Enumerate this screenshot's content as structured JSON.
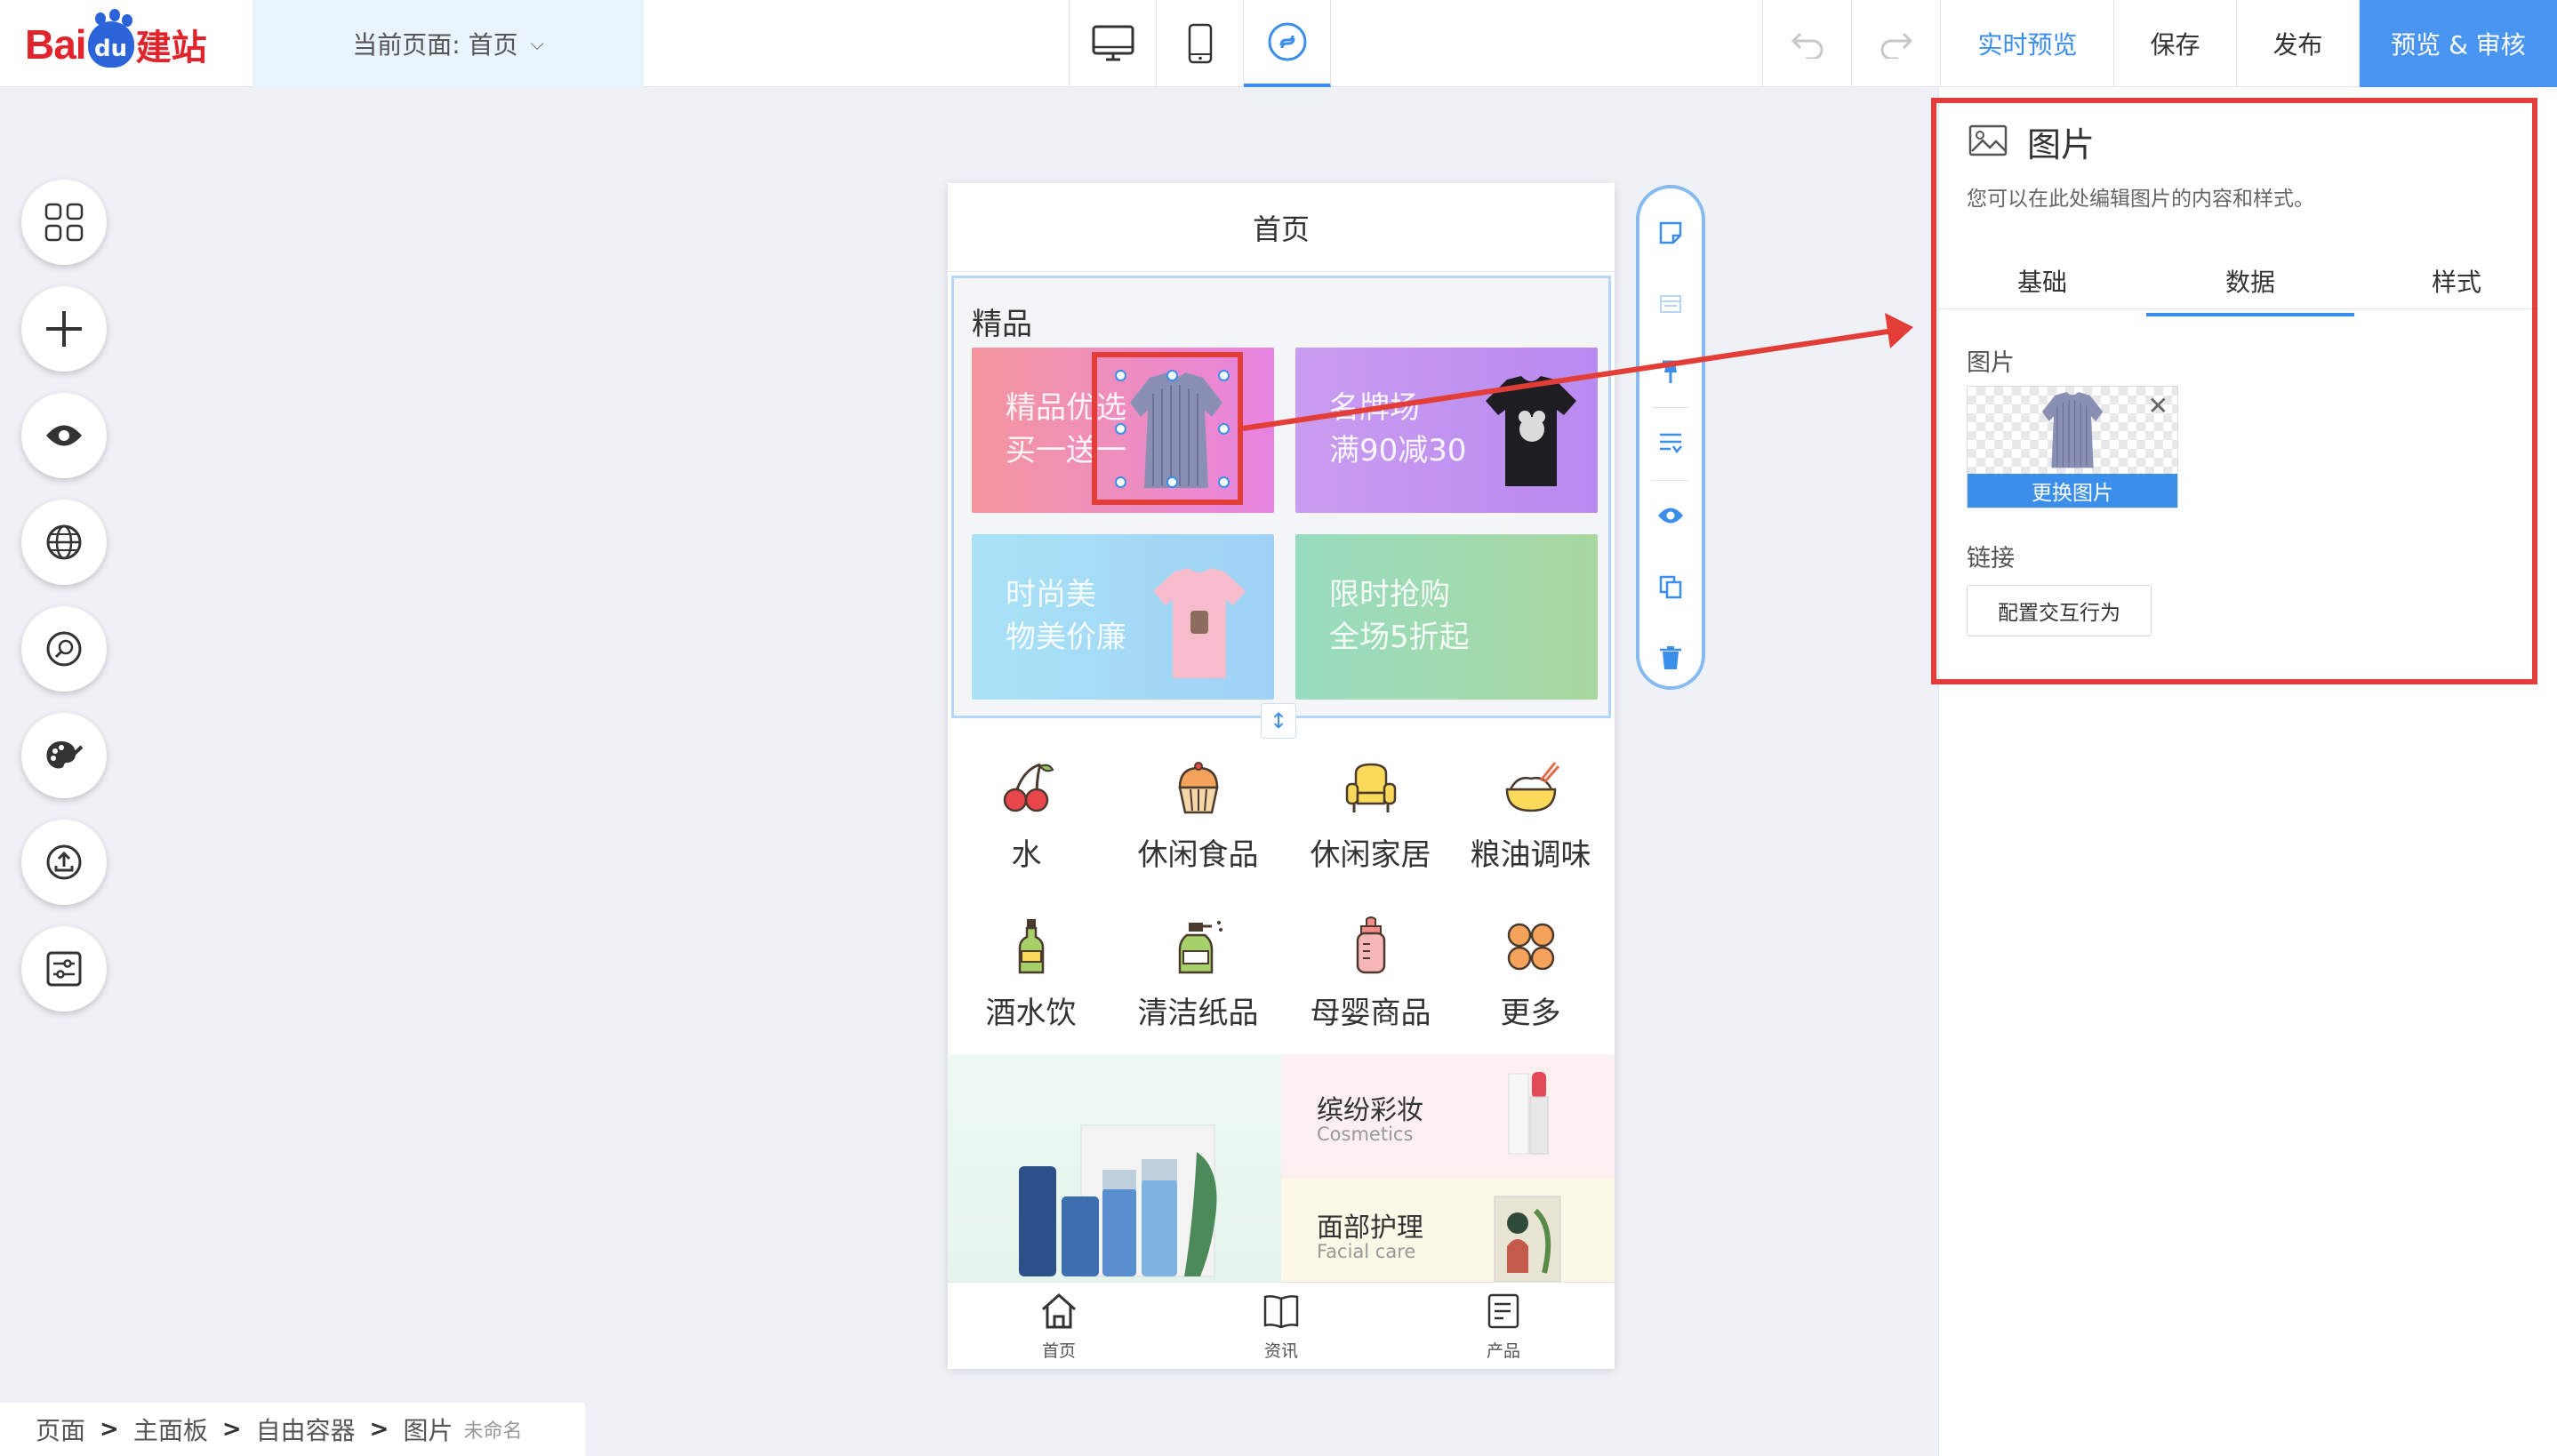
{
  "logo": {
    "left": "Bai",
    "paw": "du",
    "right": "建站"
  },
  "header": {
    "current_page": "当前页面: 首页",
    "live_preview": "实时预览",
    "save": "保存",
    "publish": "发布",
    "preview_review": "预览 & 审核"
  },
  "phone": {
    "title": "首页",
    "section_label": "精品",
    "cards": [
      {
        "line1": "精品优选",
        "line2": "买一送一"
      },
      {
        "line1": "名牌场",
        "line2": "满90减30"
      },
      {
        "line1": "时尚美",
        "line2": "物美价廉"
      },
      {
        "line1": "限时抢购",
        "line2": "全场5折起"
      }
    ],
    "categories": [
      "水",
      "休闲食品",
      "休闲家居",
      "粮油调味",
      "酒水饮",
      "清洁纸品",
      "母婴商品",
      "更多"
    ],
    "promo": [
      {
        "zh": "缤纷彩妆",
        "en": "Cosmetics"
      },
      {
        "zh": "面部护理",
        "en": "Facial care"
      }
    ],
    "tabs": [
      "首页",
      "资讯",
      "产品"
    ]
  },
  "panel": {
    "title": "图片",
    "description": "您可以在此处编辑图片的内容和样式。",
    "tabs": [
      "基础",
      "数据",
      "样式"
    ],
    "active_tab": "数据",
    "image_label": "图片",
    "change_image": "更换图片",
    "link_label": "链接",
    "config_button": "配置交互行为"
  },
  "breadcrumb": {
    "items": [
      "页面",
      "主面板",
      "自由容器",
      "图片"
    ],
    "unnamed": "未命名"
  },
  "colors": {
    "accent": "#3b8eea",
    "highlight": "#e33d37",
    "brand_red": "#e0242b",
    "brand_blue": "#2b64d9"
  }
}
